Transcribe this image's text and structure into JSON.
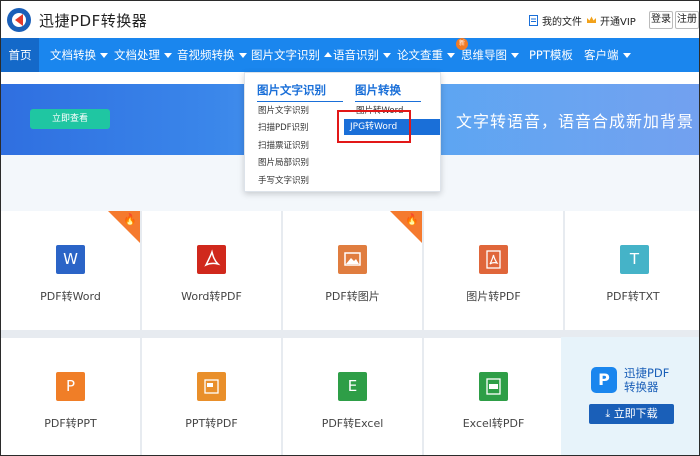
{
  "header": {
    "brand": "迅捷PDF转换器",
    "my_files": "我的文件",
    "vip": "开通VIP",
    "login": "登录",
    "register": "注册"
  },
  "nav": [
    {
      "label": "首页"
    },
    {
      "label": "文档转换"
    },
    {
      "label": "文档处理"
    },
    {
      "label": "音视频转换"
    },
    {
      "label": "图片文字识别"
    },
    {
      "label": "语音识别"
    },
    {
      "label": "论文查重"
    },
    {
      "label": "思维导图"
    },
    {
      "label": "PPT模板"
    },
    {
      "label": "客户端"
    }
  ],
  "nav_badge": "新",
  "banner": {
    "button": "立即查看",
    "text": "文字转语音，语音合成新加背景"
  },
  "dropdown": {
    "col1_title": "图片文字识别",
    "col1_items": [
      "图片文字识别",
      "扫描PDF识别",
      "扫描票证识别",
      "图片局部识别",
      "手写文字识别"
    ],
    "col2_title": "图片转换",
    "col2_items": [
      "图片转Word",
      "JPG转Word"
    ]
  },
  "tiles_row1": [
    {
      "label": "PDF转Word",
      "icon": "W",
      "color": "#2b64c7",
      "hot": true
    },
    {
      "label": "Word转PDF",
      "icon": "PDF",
      "color": "#d0281c",
      "hot": false
    },
    {
      "label": "PDF转图片",
      "icon": "IMG",
      "color": "#e07d3f",
      "hot": true
    },
    {
      "label": "图片转PDF",
      "icon": "PDF",
      "color": "#e0663a",
      "hot": false
    },
    {
      "label": "PDF转TXT",
      "icon": "T",
      "color": "#45b3c8",
      "hot": false
    }
  ],
  "tiles_row2": [
    {
      "label": "PDF转PPT",
      "icon": "P",
      "color": "#f07e27"
    },
    {
      "label": "PPT转PDF",
      "icon": "PDF",
      "color": "#e98f2a"
    },
    {
      "label": "PDF转Excel",
      "icon": "E",
      "color": "#2e9e47"
    },
    {
      "label": "Excel转PDF",
      "icon": "PDF",
      "color": "#2e9e47"
    }
  ],
  "promo": {
    "name_line1": "迅捷PDF",
    "name_line2": "转换器",
    "button": "立即下载"
  }
}
